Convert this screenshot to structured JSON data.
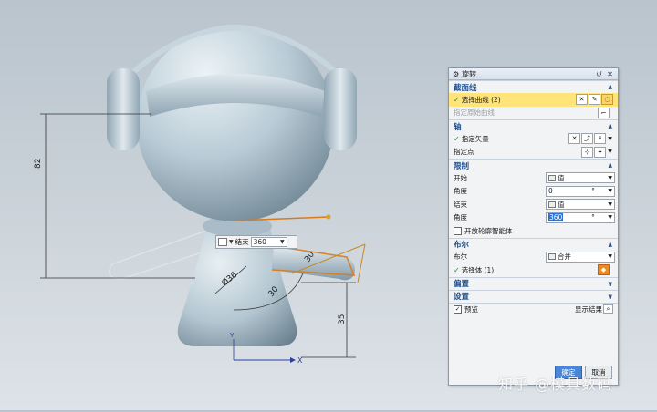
{
  "canvas": {
    "dim_vertical": "82",
    "dim_diameter": "Ø36",
    "dim_angle_top": "30",
    "dim_angle_bottom": "30",
    "dim_height": "35",
    "axis_x": "X",
    "axis_y": "Y"
  },
  "float_input": {
    "label": "结束",
    "value": "360"
  },
  "dialog": {
    "title": "旋转",
    "sections": {
      "section_curve": {
        "title": "截面线",
        "select_curve": "选择曲线 (2)",
        "specify_origin_curve": "指定原始曲线"
      },
      "axis": {
        "title": "轴",
        "specify_vector": "指定矢量",
        "specify_point": "指定点"
      },
      "limits": {
        "title": "限制",
        "start_label": "开始",
        "start_type": "值",
        "start_angle_label": "角度",
        "start_angle_value": "0",
        "end_label": "结束",
        "end_type": "值",
        "end_angle_label": "角度",
        "end_angle_value": "360",
        "unit": "°",
        "open_profile_label": "开放轮廓智能体"
      },
      "boolean": {
        "title": "布尔",
        "boolean_label": "布尔",
        "boolean_value": "合并",
        "select_body": "选择体 (1)"
      },
      "offset": {
        "title": "偏置"
      },
      "settings": {
        "title": "设置"
      }
    },
    "preview_label": "预览",
    "show_result_label": "显示结果",
    "ok_label": "确定",
    "cancel_label": "取消"
  },
  "watermark": "知乎 @模具数码",
  "colors": {
    "highlight": "#ffe47a",
    "section_title": "#1f4f8c",
    "ok_button": "#4a86d8",
    "model_body": "#b9cbd6"
  },
  "icons": {
    "dialog": "gear-icon",
    "reset": "reset-icon",
    "close": "close-icon",
    "expand": "chevron-up-icon",
    "collapse": "chevron-down-icon",
    "check": "check-icon"
  }
}
